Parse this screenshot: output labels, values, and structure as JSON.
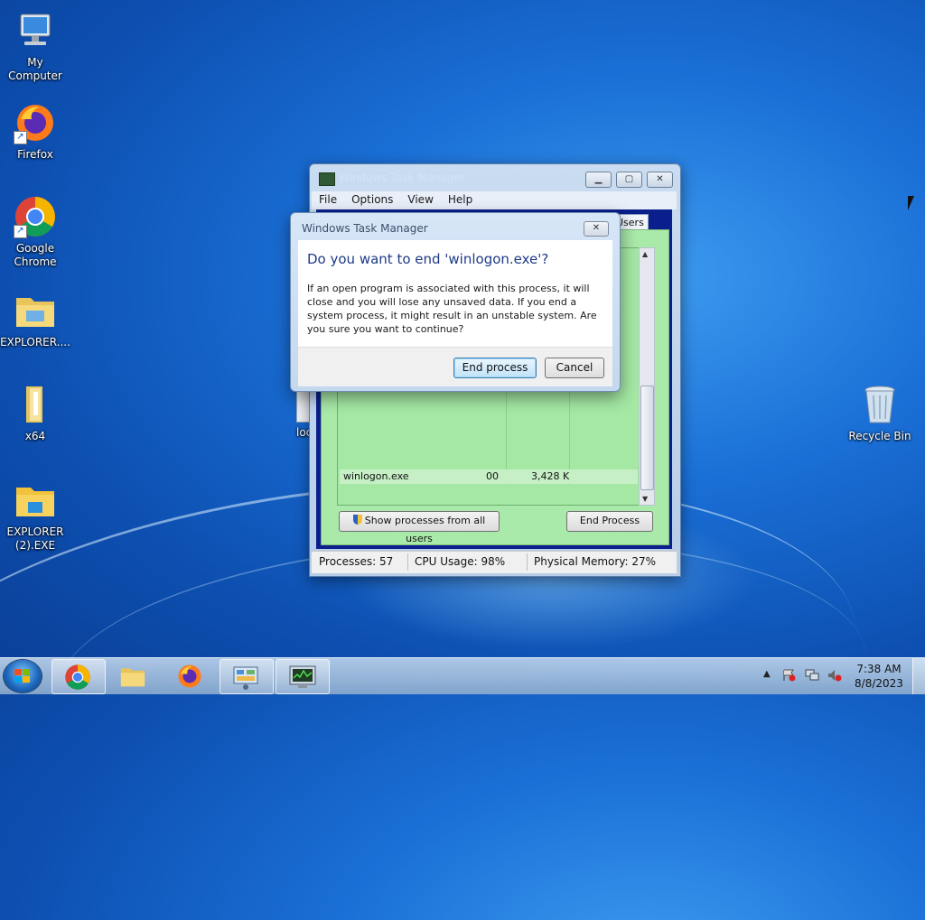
{
  "desktop": {
    "icons": [
      {
        "label": "My Computer",
        "name": "my-computer"
      },
      {
        "label": "Firefox",
        "name": "firefox"
      },
      {
        "label": "Google Chrome",
        "name": "google-chrome"
      },
      {
        "label": "EXPLORER....",
        "name": "explorer"
      },
      {
        "label": "x64",
        "name": "x64-folder"
      },
      {
        "label": "EXPLORER (2).EXE",
        "name": "explorer-2"
      },
      {
        "label": "Recycle Bin",
        "name": "recycle-bin"
      },
      {
        "label": "loc",
        "name": "partial-icon"
      }
    ]
  },
  "task_manager": {
    "title": "Windows Task Manager",
    "menu": [
      "File",
      "Options",
      "View",
      "Help"
    ],
    "visible_tab": "Users",
    "process_row": {
      "name": "winlogon.exe",
      "cpu": "00",
      "memory": "3,428 K"
    },
    "show_all_label": "Show processes from all users",
    "end_process_label": "End Process",
    "status": {
      "processes": "Processes: 57",
      "cpu": "CPU Usage: 98%",
      "memory": "Physical Memory: 27%"
    }
  },
  "dialog": {
    "title": "Windows Task Manager",
    "heading": "Do you want to end 'winlogon.exe'?",
    "message": "If an open program is associated with this process, it will close and you will lose any unsaved data. If you end a system process, it might result in an unstable system. Are you sure you want to continue?",
    "confirm_label": "End process",
    "cancel_label": "Cancel"
  },
  "taskbar": {
    "time": "7:38 AM",
    "date": "8/8/2023"
  }
}
